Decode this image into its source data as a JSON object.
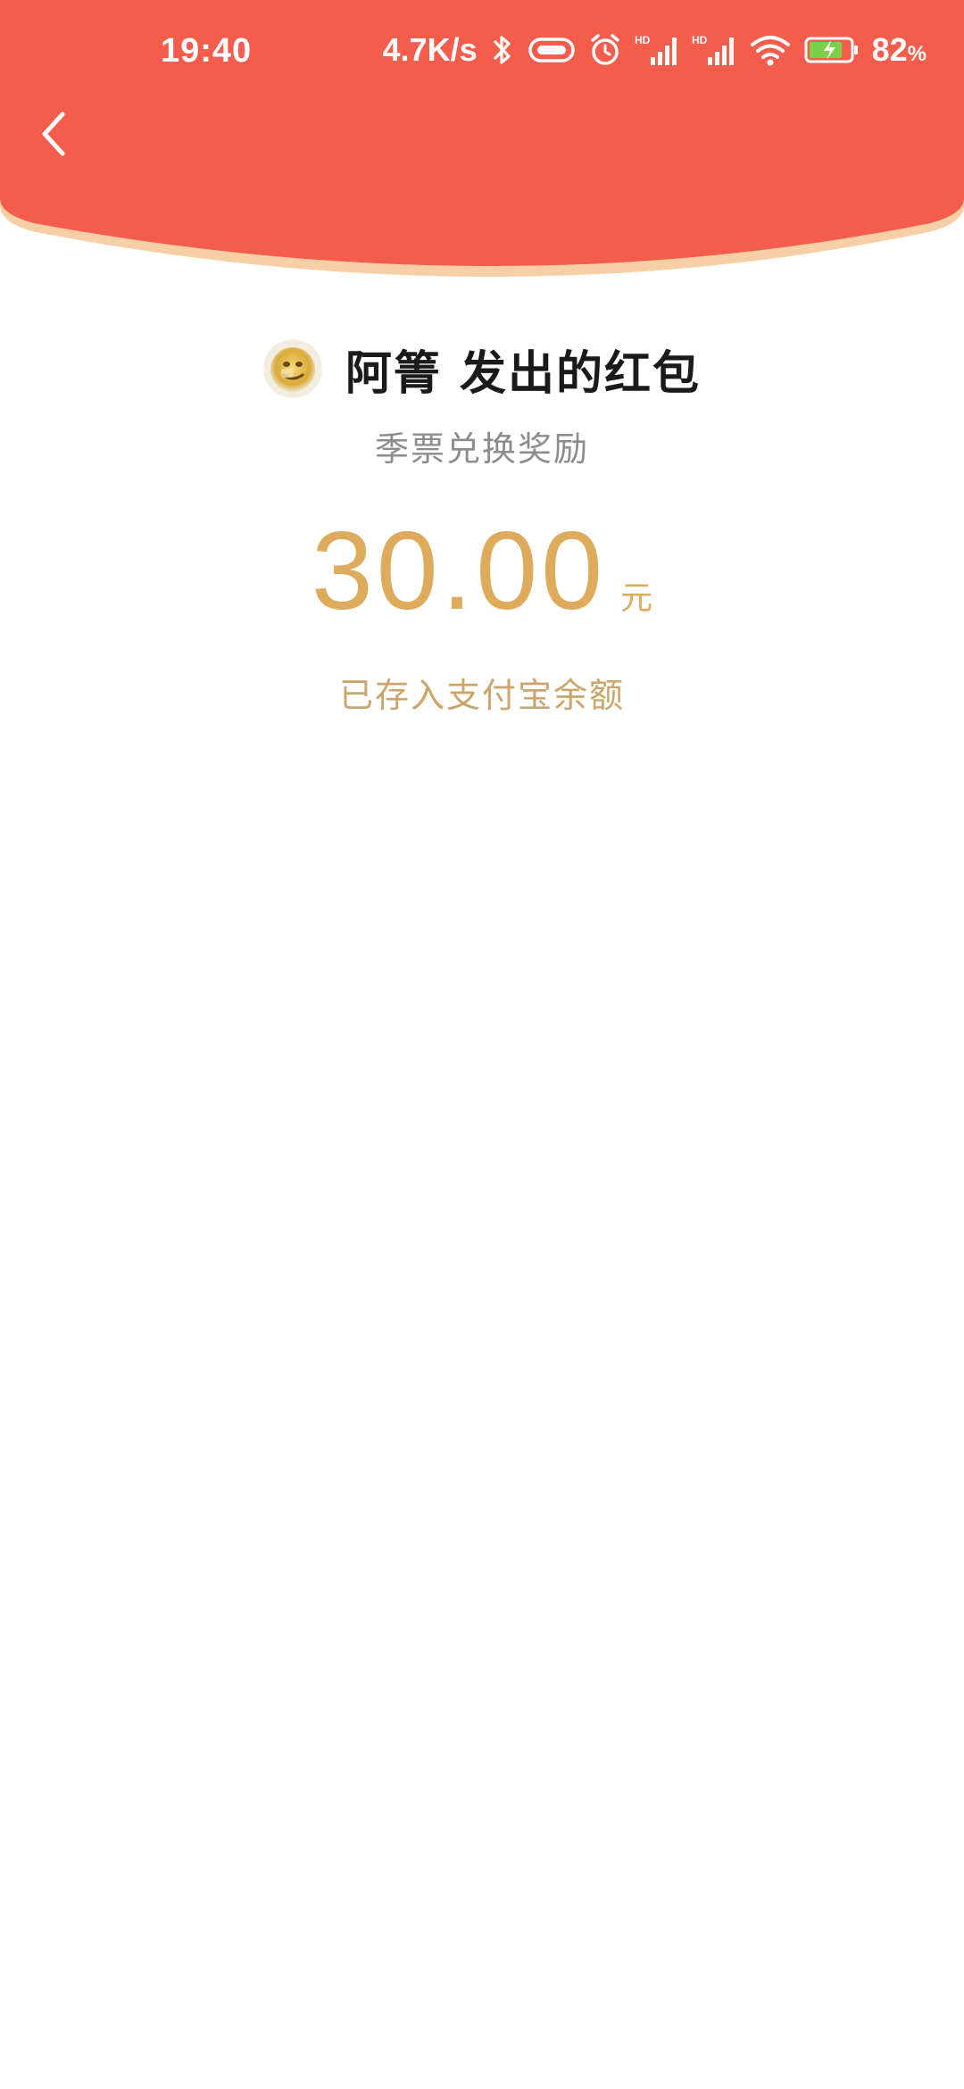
{
  "status_bar": {
    "time": "19:40",
    "net_speed": "4.7K/s",
    "battery_percent": "82",
    "battery_unit": "%",
    "signal_label_1": "HD",
    "signal_label_2": "HD",
    "icons": [
      "bluetooth-icon",
      "vibrate-icon",
      "alarm-icon",
      "signal-hd-icon",
      "signal-hd-icon",
      "wifi-icon",
      "battery-charging-icon"
    ]
  },
  "header": {
    "back_icon": "back-chevron-icon",
    "color": "#f45d4c"
  },
  "envelope": {
    "sender_name": "阿箐",
    "title_suffix": "发出的红包",
    "message": "季票兑换奖励",
    "amount": "30.00",
    "currency_unit": "元",
    "status": "已存入支付宝余额"
  },
  "colors": {
    "header_red": "#f45d4c",
    "header_edge": "#f7c9a0",
    "amount_gold": "#deaa5c",
    "status_gold": "#cba56a",
    "subtitle_gray": "#8c8c8c"
  }
}
